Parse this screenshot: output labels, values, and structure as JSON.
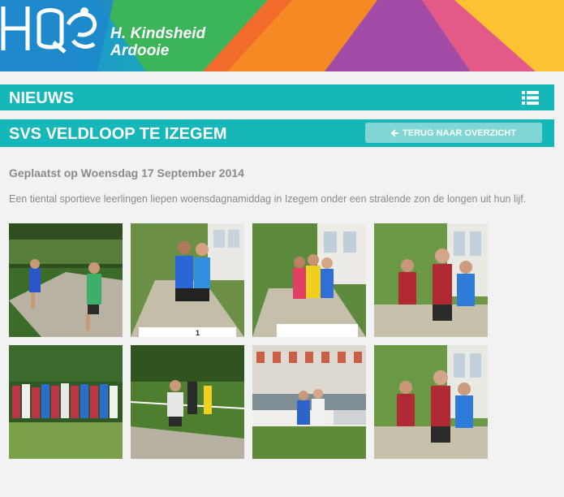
{
  "header": {
    "brand_line1": "H. Kindsheid",
    "brand_line2": "Ardooie",
    "logo_icon": "school-logo-icon"
  },
  "nieuws": {
    "title": "NIEUWS",
    "menu_icon": "list-icon"
  },
  "article": {
    "title": "SVS VELDLOOP TE IZEGEM",
    "back_label": "TERUG NAAR OVERZICHT",
    "back_icon": "arrow-left-icon",
    "posted": "Geplaatst op Woensdag 17 September 2014",
    "intro": "Een tiental sportieve leerlingen liepen woensdagnamiddag in Izegem onder een stralende zon de longen uit hun lijf."
  },
  "gallery": {
    "photos": [
      {
        "name": "runners-on-path"
      },
      {
        "name": "two-girls-podium"
      },
      {
        "name": "three-girls-podium"
      },
      {
        "name": "three-boys-medals"
      },
      {
        "name": "group-at-start"
      },
      {
        "name": "runner-finish-line"
      },
      {
        "name": "building-crowd"
      },
      {
        "name": "three-boys-medals-2"
      }
    ]
  },
  "colors": {
    "teal": "#16b7b9",
    "button": "#7fd6d4",
    "text_grey": "#8a8a8a"
  }
}
